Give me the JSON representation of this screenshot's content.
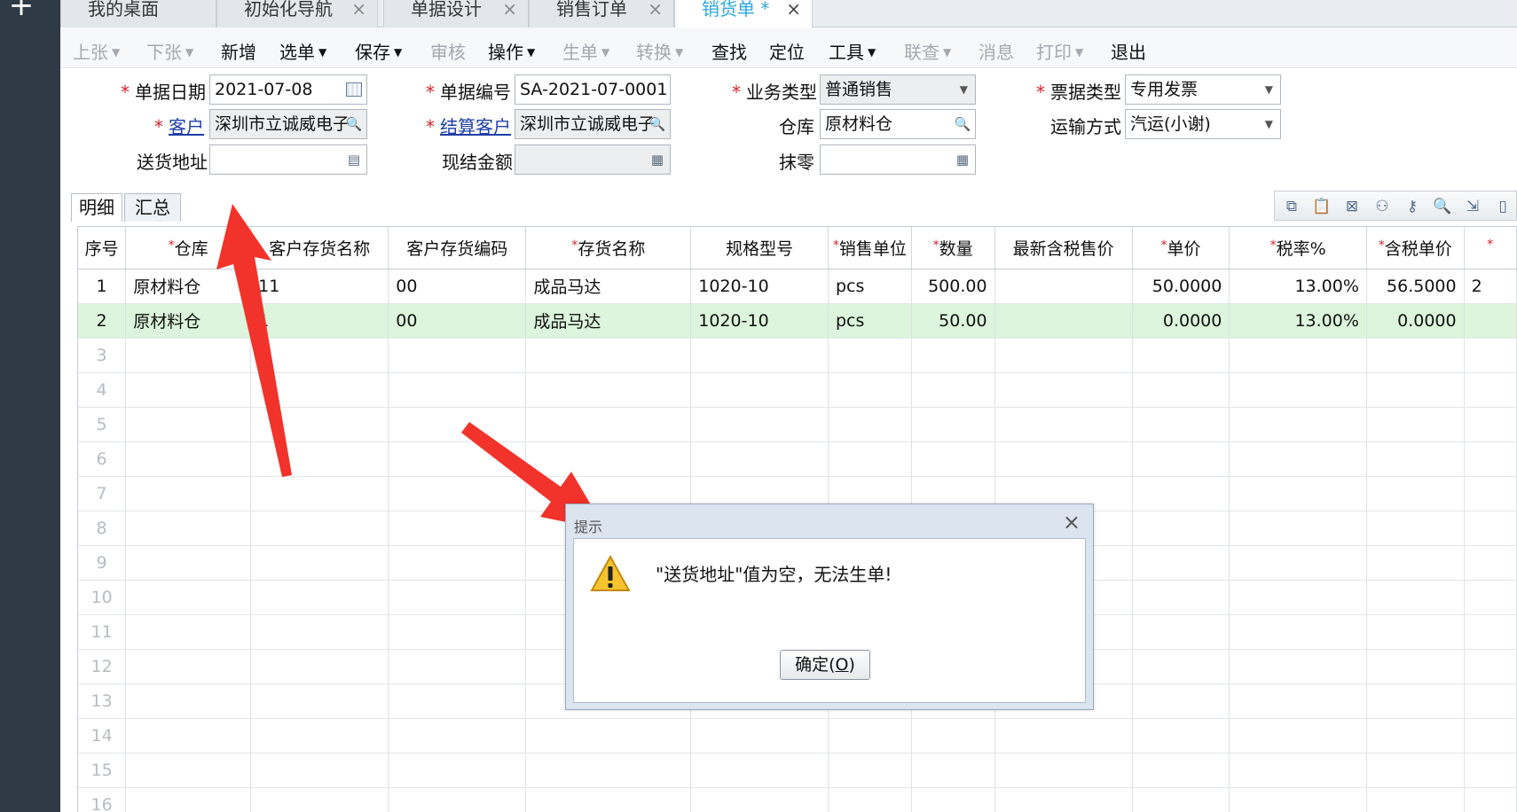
{
  "tabs": [
    {
      "label": "我的桌面",
      "closable": false
    },
    {
      "label": "初始化导航",
      "closable": true
    },
    {
      "label": "单据设计",
      "closable": true
    },
    {
      "label": "销售订单",
      "closable": true
    },
    {
      "label": "销货单 *",
      "closable": true,
      "active": true
    }
  ],
  "toolbar": {
    "prev": "上张",
    "next": "下张",
    "new": "新增",
    "select": "选单",
    "save": "保存",
    "audit": "审核",
    "operate": "操作",
    "generate": "生单",
    "convert": "转换",
    "find": "查找",
    "locate": "定位",
    "tools": "工具",
    "linkquery": "联查",
    "message": "消息",
    "print": "打印",
    "exit": "退出"
  },
  "form": {
    "date_label": "单据日期",
    "date_value": "2021-07-08",
    "docno_label": "单据编号",
    "docno_value": "SA-2021-07-0001",
    "biztype_label": "业务类型",
    "biztype_value": "普通销售",
    "invoice_label": "票据类型",
    "invoice_value": "专用发票",
    "customer_label": "客户",
    "customer_value": "深圳市立诚威电子",
    "settle_label": "结算客户",
    "settle_value": "深圳市立诚威电子",
    "warehouse_label": "仓库",
    "warehouse_value": "原材料仓",
    "transport_label": "运输方式",
    "transport_value": "汽运(小谢)",
    "address_label": "送货地址",
    "address_value": "",
    "cash_label": "现结金额",
    "cash_value": "",
    "rounding_label": "抹零",
    "rounding_value": ""
  },
  "detail_tabs": {
    "detail": "明细",
    "summary": "汇总"
  },
  "grid": {
    "headers": [
      {
        "label": "序号",
        "req": false
      },
      {
        "label": "仓库",
        "req": true
      },
      {
        "label": "客户存货名称",
        "req": false
      },
      {
        "label": "客户存货编码",
        "req": false
      },
      {
        "label": "存货名称",
        "req": true
      },
      {
        "label": "规格型号",
        "req": false
      },
      {
        "label": "销售单位",
        "req": true
      },
      {
        "label": "数量",
        "req": true
      },
      {
        "label": "最新含税售价",
        "req": false
      },
      {
        "label": "单价",
        "req": true
      },
      {
        "label": "税率%",
        "req": true
      },
      {
        "label": "含税单价",
        "req": true
      },
      {
        "label": "",
        "req": true
      }
    ],
    "rows": [
      [
        "1",
        "原材料仓",
        "11",
        "00",
        "成品马达",
        "1020-10",
        "pcs",
        "500.00",
        "",
        "50.0000",
        "13.00%",
        "56.5000",
        "2"
      ],
      [
        "2",
        "原材料仓",
        "1",
        "00",
        "成品马达",
        "1020-10",
        "pcs",
        "50.00",
        "",
        "0.0000",
        "13.00%",
        "0.0000",
        ""
      ],
      [
        "3"
      ],
      [
        "4"
      ],
      [
        "5"
      ],
      [
        "6"
      ],
      [
        "7"
      ],
      [
        "8"
      ],
      [
        "9"
      ],
      [
        "10"
      ],
      [
        "11"
      ],
      [
        "12"
      ],
      [
        "13"
      ],
      [
        "14"
      ],
      [
        "15"
      ],
      [
        "16"
      ]
    ]
  },
  "dialog": {
    "title": "提示",
    "message": "\"送货地址\"值为空，无法生单!",
    "ok_label": "确定(",
    "ok_key": "O",
    "ok_label_end": ")",
    "close": "×"
  },
  "colors": {
    "accent": "#2ea7e0",
    "required": "#d8212a",
    "arrow": "#f2332b",
    "selected_row": "#dcf5dc"
  }
}
